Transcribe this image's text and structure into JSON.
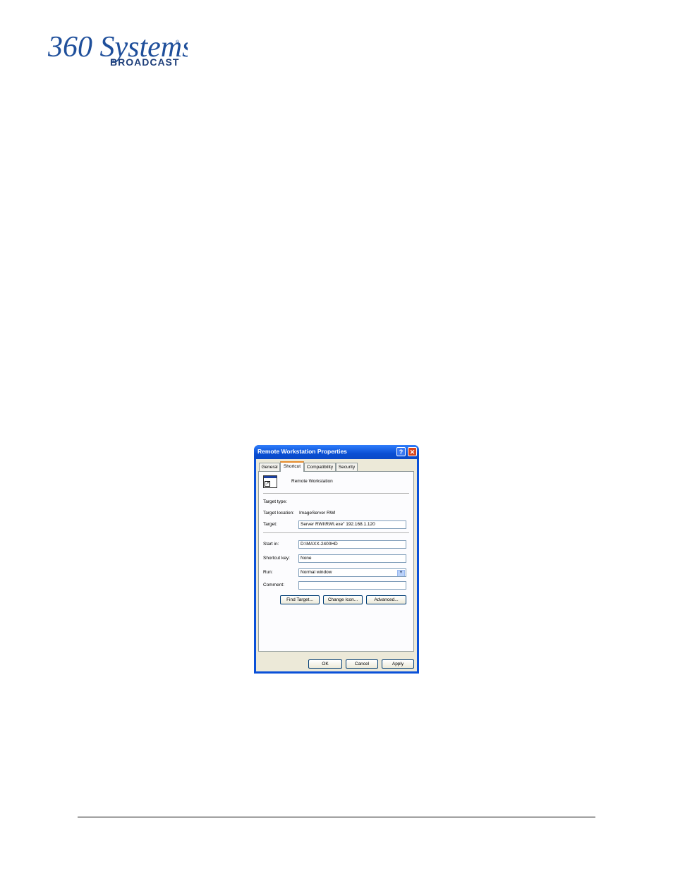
{
  "brand": {
    "logo_script": "360 Systems",
    "logo_sub": "BROADCAST",
    "registered": "®"
  },
  "dialog": {
    "title": "Remote Workstation Properties",
    "help_glyph": "?",
    "close_glyph": "✕",
    "tabs": [
      {
        "label": "General"
      },
      {
        "label": "Shortcut",
        "selected": true
      },
      {
        "label": "Compatibility"
      },
      {
        "label": "Security"
      }
    ],
    "shortcut_name": "Remote Workstation",
    "target_type_label": "Target type:",
    "target_type_value": "",
    "target_location_label": "Target location:",
    "target_location_value": "ImageServer RWI",
    "target_label": "Target:",
    "target_value": "Server RWI\\RWI.exe\" 192.168.1.120",
    "start_in_label": "Start in:",
    "start_in_value": "D:\\MAXX-2400HD",
    "shortcut_key_label": "Shortcut key:",
    "shortcut_key_value": "None",
    "run_label": "Run:",
    "run_value": "Normal window",
    "comment_label": "Comment:",
    "comment_value": "",
    "find_target_button": "Find Target...",
    "change_icon_button": "Change Icon...",
    "advanced_button": "Advanced...",
    "ok_button": "OK",
    "cancel_button": "Cancel",
    "apply_button": "Apply"
  },
  "colors": {
    "brand_blue": "#1f4f9b",
    "titlebar_blue": "#0a50d8",
    "dialog_face": "#ece9d8",
    "tab_highlight": "#e68b2c",
    "close_red": "#d9461e"
  }
}
